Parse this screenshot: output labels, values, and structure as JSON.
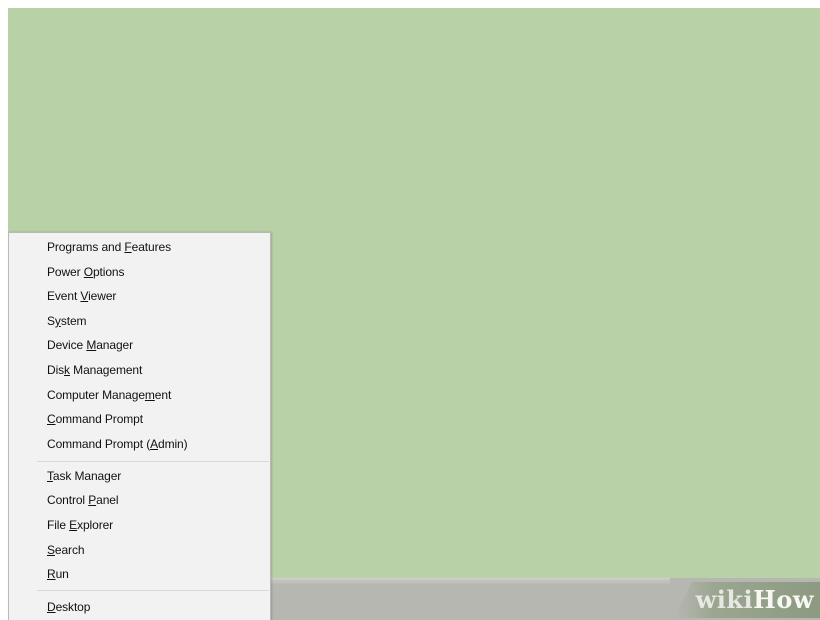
{
  "desktop": {
    "background_color": "#b9d1a6",
    "taskbar_color": "#b7b7b2"
  },
  "context_menu": {
    "name": "Quick Link Menu",
    "group_1": [
      {
        "label": "Programs and Features",
        "access_key_index": 13
      },
      {
        "label": "Power Options",
        "access_key_index": 6
      },
      {
        "label": "Event Viewer",
        "access_key_index": 6
      },
      {
        "label": "System",
        "access_key_index": 1
      },
      {
        "label": "Device Manager",
        "access_key_index": 7
      },
      {
        "label": "Disk Management",
        "access_key_index": 3
      },
      {
        "label": "Computer Management",
        "access_key_index": 15
      },
      {
        "label": "Command Prompt",
        "access_key_index": 0
      },
      {
        "label": "Command Prompt (Admin)",
        "access_key_index": 16
      }
    ],
    "group_2": [
      {
        "label": "Task Manager",
        "access_key_index": 0
      },
      {
        "label": "Control Panel",
        "access_key_index": 8
      },
      {
        "label": "File Explorer",
        "access_key_index": 5
      },
      {
        "label": "Search",
        "access_key_index": 0
      },
      {
        "label": "Run",
        "access_key_index": 0
      }
    ],
    "group_3": [
      {
        "label": "Desktop",
        "access_key_index": 0
      }
    ]
  },
  "watermark": {
    "part1": "wiki",
    "part2": "How"
  }
}
